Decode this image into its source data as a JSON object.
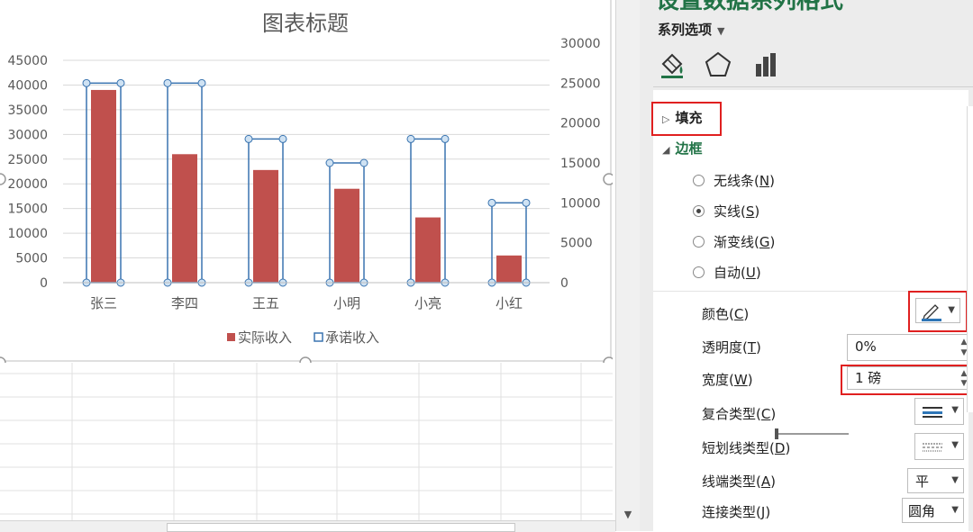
{
  "chart_data": {
    "type": "bar",
    "title": "图表标题",
    "categories": [
      "张三",
      "李四",
      "王五",
      "小明",
      "小亮",
      "小红"
    ],
    "series": [
      {
        "name": "实际收入",
        "axis": "primary",
        "style": "filled",
        "color": "#c0504d",
        "values": [
          39000,
          26000,
          22800,
          19000,
          13200,
          5500
        ]
      },
      {
        "name": "承诺收入",
        "axis": "secondary",
        "style": "outline",
        "color": "#3a74b0",
        "values": [
          25000,
          25000,
          18000,
          15000,
          18000,
          10000
        ]
      }
    ],
    "ylim": [
      0,
      45000
    ],
    "y_ticks": [
      "45000",
      "40000",
      "35000",
      "30000",
      "25000",
      "20000",
      "15000",
      "10000",
      "5000",
      "0"
    ],
    "ylim_secondary": [
      0,
      30000
    ],
    "y2_ticks": [
      "30000",
      "25000",
      "20000",
      "15000",
      "10000",
      "5000",
      "0"
    ],
    "legend_position": "bottom",
    "grid": true
  },
  "pane": {
    "title": "设置数据系列格式",
    "series_options_label": "系列选项",
    "tab_icons": [
      "fill-line-icon",
      "effects-pentagon-icon",
      "series-options-bars-icon"
    ],
    "fill_section": "填充",
    "border_section": "边框",
    "line_options": [
      {
        "label": "无线条",
        "key": "N",
        "selected": false
      },
      {
        "label": "实线",
        "key": "S",
        "selected": true
      },
      {
        "label": "渐变线",
        "key": "G",
        "selected": false
      },
      {
        "label": "自动",
        "key": "U",
        "selected": false
      }
    ],
    "color_label": "颜色",
    "color_key": "C",
    "transparency_label": "透明度",
    "transparency_key": "T",
    "transparency_value": "0%",
    "transparency_level": 0,
    "width_label": "宽度",
    "width_key": "W",
    "width_value": "1 磅",
    "compound_label": "复合类型",
    "compound_key": "C",
    "dash_label": "短划线类型",
    "dash_key": "D",
    "cap_label": "线端类型",
    "cap_key": "A",
    "cap_value": "平",
    "join_label": "连接类型",
    "join_key": "J",
    "join_value": "圆角",
    "accent_color": "#217346",
    "pen_color": "#2e75b6"
  }
}
